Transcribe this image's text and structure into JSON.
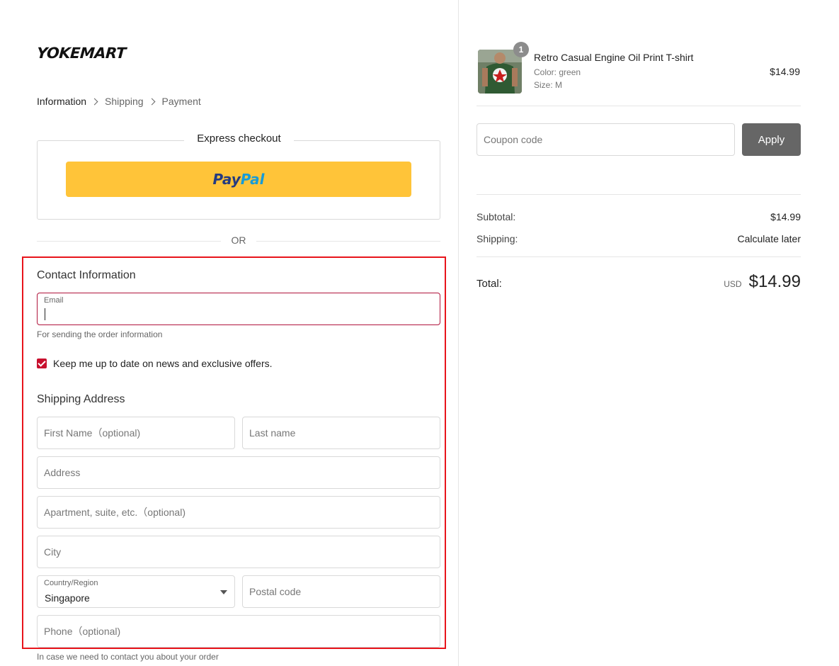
{
  "brand": {
    "logo_text": "YOKEMART"
  },
  "breadcrumb": {
    "items": [
      "Information",
      "Shipping",
      "Payment"
    ]
  },
  "express": {
    "title": "Express checkout",
    "paypal_pay": "Pay",
    "paypal_pal": "Pal"
  },
  "divider": {
    "or": "OR"
  },
  "contact": {
    "title": "Contact Information",
    "email_label": "Email",
    "email_value": "",
    "email_hint": "For sending the order information",
    "newsletter_label": "Keep me up to date on news and exclusive offers.",
    "newsletter_checked": true
  },
  "shipping": {
    "title": "Shipping Address",
    "first_name_placeholder": "First Name（optional)",
    "last_name_placeholder": "Last name",
    "address_placeholder": "Address",
    "apartment_placeholder": "Apartment, suite, etc.（optional)",
    "city_placeholder": "City",
    "country_label": "Country/Region",
    "country_value": "Singapore",
    "postal_placeholder": "Postal code",
    "phone_placeholder": "Phone（optional)",
    "phone_hint": "In case we need to contact you about your order"
  },
  "cart": {
    "quantity": "1",
    "product_name": "Retro Casual Engine Oil Print T-shirt",
    "color_line": "Color:  green",
    "size_line": "Size:  M",
    "price": "$14.99"
  },
  "coupon": {
    "placeholder": "Coupon code",
    "apply_label": "Apply"
  },
  "summary": {
    "subtotal_label": "Subtotal:",
    "subtotal_value": "$14.99",
    "shipping_label": "Shipping:",
    "shipping_value": "Calculate later",
    "total_label": "Total:",
    "currency": "USD",
    "total_value": "$14.99"
  },
  "colors": {
    "accent": "#c8102e",
    "paypal_yellow": "#ffc439",
    "highlight_red": "#e8141b",
    "apply_bg": "#666666"
  }
}
